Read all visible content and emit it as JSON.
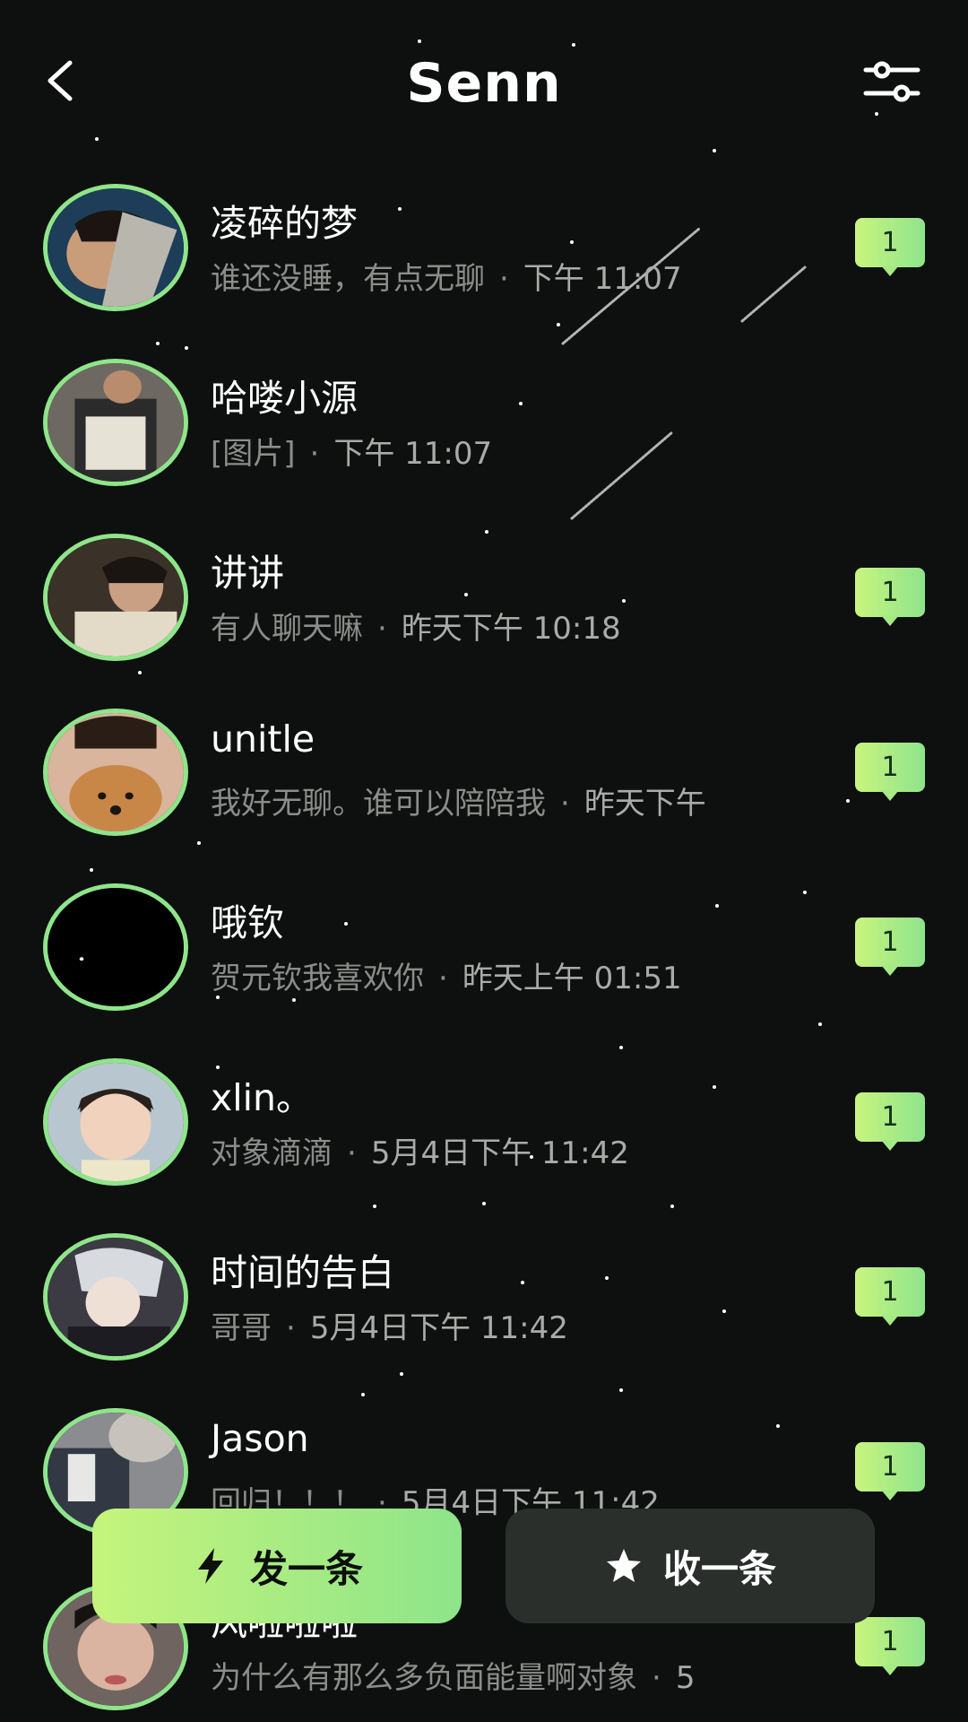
{
  "header": {
    "title": "Senn",
    "back_icon": "chevron-left-icon",
    "filter_icon": "sliders-icon"
  },
  "conversations": [
    {
      "name": "凌碎的梦",
      "preview": "谁还没睡，有点无聊",
      "time": "下午 11:07",
      "unread": "1",
      "avatar_icon": "avatar-photo-1"
    },
    {
      "name": "哈喽小源",
      "preview": "[图片]",
      "time": "下午 11:07",
      "unread": "",
      "avatar_icon": "avatar-photo-2"
    },
    {
      "name": "讲讲",
      "preview": "有人聊天嘛",
      "time": "昨天下午 10:18",
      "unread": "1",
      "avatar_icon": "avatar-photo-3"
    },
    {
      "name": "unitle",
      "preview": "我好无聊。谁可以陪陪我",
      "time": "昨天下午",
      "unread": "1",
      "avatar_icon": "avatar-photo-4"
    },
    {
      "name": "哦钦",
      "preview": "贺元钦我喜欢你",
      "time": "昨天上午 01:51",
      "unread": "1",
      "avatar_icon": "avatar-photo-5"
    },
    {
      "name": "xlin。",
      "preview": "对象滴滴",
      "time": "5月4日下午 11:42",
      "unread": "1",
      "avatar_icon": "avatar-photo-6"
    },
    {
      "name": "时间的告白",
      "preview": "哥哥",
      "time": "5月4日下午 11:42",
      "unread": "1",
      "avatar_icon": "avatar-photo-7"
    },
    {
      "name": "Jason",
      "preview": "回归！！！",
      "time": "5月4日下午 11:42",
      "unread": "1",
      "avatar_icon": "avatar-photo-8"
    },
    {
      "name": "风啦啦啦",
      "preview": "为什么有那么多负面能量啊对象",
      "time": "5",
      "unread": "1",
      "avatar_icon": "avatar-photo-9"
    }
  ],
  "actions": {
    "send_label": "发一条",
    "receive_label": "收一条",
    "send_icon": "lightning-icon",
    "receive_icon": "star-icon"
  },
  "colors": {
    "background": "#0d100e",
    "accent_green": "#8fe58a",
    "accent_lime": "#c8f57e",
    "muted_text": "#8a8d8a"
  }
}
